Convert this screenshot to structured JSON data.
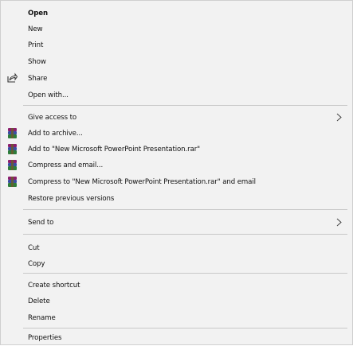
{
  "menu": {
    "open": "Open",
    "new": "New",
    "print": "Print",
    "show": "Show",
    "share": "Share",
    "open_with": "Open with...",
    "give_access": "Give access to",
    "add_archive": "Add to archive...",
    "add_rar": "Add to \"New Microsoft PowerPoint Presentation.rar\"",
    "compress_email": "Compress and email...",
    "compress_rar_email": "Compress to \"New Microsoft PowerPoint Presentation.rar\" and email",
    "restore": "Restore previous versions",
    "send_to": "Send to",
    "cut": "Cut",
    "copy": "Copy",
    "create_shortcut": "Create shortcut",
    "delete": "Delete",
    "rename": "Rename",
    "properties": "Properties"
  },
  "icons": {
    "share": "share-icon",
    "archive": "winrar-icon",
    "submenu": "chevron-right-icon"
  },
  "colors": {
    "background": "#f2f2f2",
    "separator": "#c8c8c8",
    "text": "#111111"
  }
}
